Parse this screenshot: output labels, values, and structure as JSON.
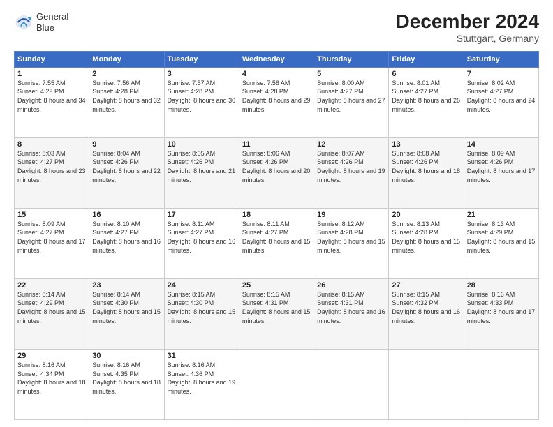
{
  "header": {
    "logo": {
      "line1": "General",
      "line2": "Blue"
    },
    "title": "December 2024",
    "subtitle": "Stuttgart, Germany"
  },
  "days": [
    "Sunday",
    "Monday",
    "Tuesday",
    "Wednesday",
    "Thursday",
    "Friday",
    "Saturday"
  ],
  "weeks": [
    [
      {
        "num": "1",
        "sunrise": "7:55 AM",
        "sunset": "4:29 PM",
        "daylight": "8 hours and 34 minutes."
      },
      {
        "num": "2",
        "sunrise": "7:56 AM",
        "sunset": "4:28 PM",
        "daylight": "8 hours and 32 minutes."
      },
      {
        "num": "3",
        "sunrise": "7:57 AM",
        "sunset": "4:28 PM",
        "daylight": "8 hours and 30 minutes."
      },
      {
        "num": "4",
        "sunrise": "7:58 AM",
        "sunset": "4:28 PM",
        "daylight": "8 hours and 29 minutes."
      },
      {
        "num": "5",
        "sunrise": "8:00 AM",
        "sunset": "4:27 PM",
        "daylight": "8 hours and 27 minutes."
      },
      {
        "num": "6",
        "sunrise": "8:01 AM",
        "sunset": "4:27 PM",
        "daylight": "8 hours and 26 minutes."
      },
      {
        "num": "7",
        "sunrise": "8:02 AM",
        "sunset": "4:27 PM",
        "daylight": "8 hours and 24 minutes."
      }
    ],
    [
      {
        "num": "8",
        "sunrise": "8:03 AM",
        "sunset": "4:27 PM",
        "daylight": "8 hours and 23 minutes."
      },
      {
        "num": "9",
        "sunrise": "8:04 AM",
        "sunset": "4:26 PM",
        "daylight": "8 hours and 22 minutes."
      },
      {
        "num": "10",
        "sunrise": "8:05 AM",
        "sunset": "4:26 PM",
        "daylight": "8 hours and 21 minutes."
      },
      {
        "num": "11",
        "sunrise": "8:06 AM",
        "sunset": "4:26 PM",
        "daylight": "8 hours and 20 minutes."
      },
      {
        "num": "12",
        "sunrise": "8:07 AM",
        "sunset": "4:26 PM",
        "daylight": "8 hours and 19 minutes."
      },
      {
        "num": "13",
        "sunrise": "8:08 AM",
        "sunset": "4:26 PM",
        "daylight": "8 hours and 18 minutes."
      },
      {
        "num": "14",
        "sunrise": "8:09 AM",
        "sunset": "4:26 PM",
        "daylight": "8 hours and 17 minutes."
      }
    ],
    [
      {
        "num": "15",
        "sunrise": "8:09 AM",
        "sunset": "4:27 PM",
        "daylight": "8 hours and 17 minutes."
      },
      {
        "num": "16",
        "sunrise": "8:10 AM",
        "sunset": "4:27 PM",
        "daylight": "8 hours and 16 minutes."
      },
      {
        "num": "17",
        "sunrise": "8:11 AM",
        "sunset": "4:27 PM",
        "daylight": "8 hours and 16 minutes."
      },
      {
        "num": "18",
        "sunrise": "8:11 AM",
        "sunset": "4:27 PM",
        "daylight": "8 hours and 15 minutes."
      },
      {
        "num": "19",
        "sunrise": "8:12 AM",
        "sunset": "4:28 PM",
        "daylight": "8 hours and 15 minutes."
      },
      {
        "num": "20",
        "sunrise": "8:13 AM",
        "sunset": "4:28 PM",
        "daylight": "8 hours and 15 minutes."
      },
      {
        "num": "21",
        "sunrise": "8:13 AM",
        "sunset": "4:29 PM",
        "daylight": "8 hours and 15 minutes."
      }
    ],
    [
      {
        "num": "22",
        "sunrise": "8:14 AM",
        "sunset": "4:29 PM",
        "daylight": "8 hours and 15 minutes."
      },
      {
        "num": "23",
        "sunrise": "8:14 AM",
        "sunset": "4:30 PM",
        "daylight": "8 hours and 15 minutes."
      },
      {
        "num": "24",
        "sunrise": "8:15 AM",
        "sunset": "4:30 PM",
        "daylight": "8 hours and 15 minutes."
      },
      {
        "num": "25",
        "sunrise": "8:15 AM",
        "sunset": "4:31 PM",
        "daylight": "8 hours and 15 minutes."
      },
      {
        "num": "26",
        "sunrise": "8:15 AM",
        "sunset": "4:31 PM",
        "daylight": "8 hours and 16 minutes."
      },
      {
        "num": "27",
        "sunrise": "8:15 AM",
        "sunset": "4:32 PM",
        "daylight": "8 hours and 16 minutes."
      },
      {
        "num": "28",
        "sunrise": "8:16 AM",
        "sunset": "4:33 PM",
        "daylight": "8 hours and 17 minutes."
      }
    ],
    [
      {
        "num": "29",
        "sunrise": "8:16 AM",
        "sunset": "4:34 PM",
        "daylight": "8 hours and 18 minutes."
      },
      {
        "num": "30",
        "sunrise": "8:16 AM",
        "sunset": "4:35 PM",
        "daylight": "8 hours and 18 minutes."
      },
      {
        "num": "31",
        "sunrise": "8:16 AM",
        "sunset": "4:36 PM",
        "daylight": "8 hours and 19 minutes."
      },
      null,
      null,
      null,
      null
    ]
  ]
}
